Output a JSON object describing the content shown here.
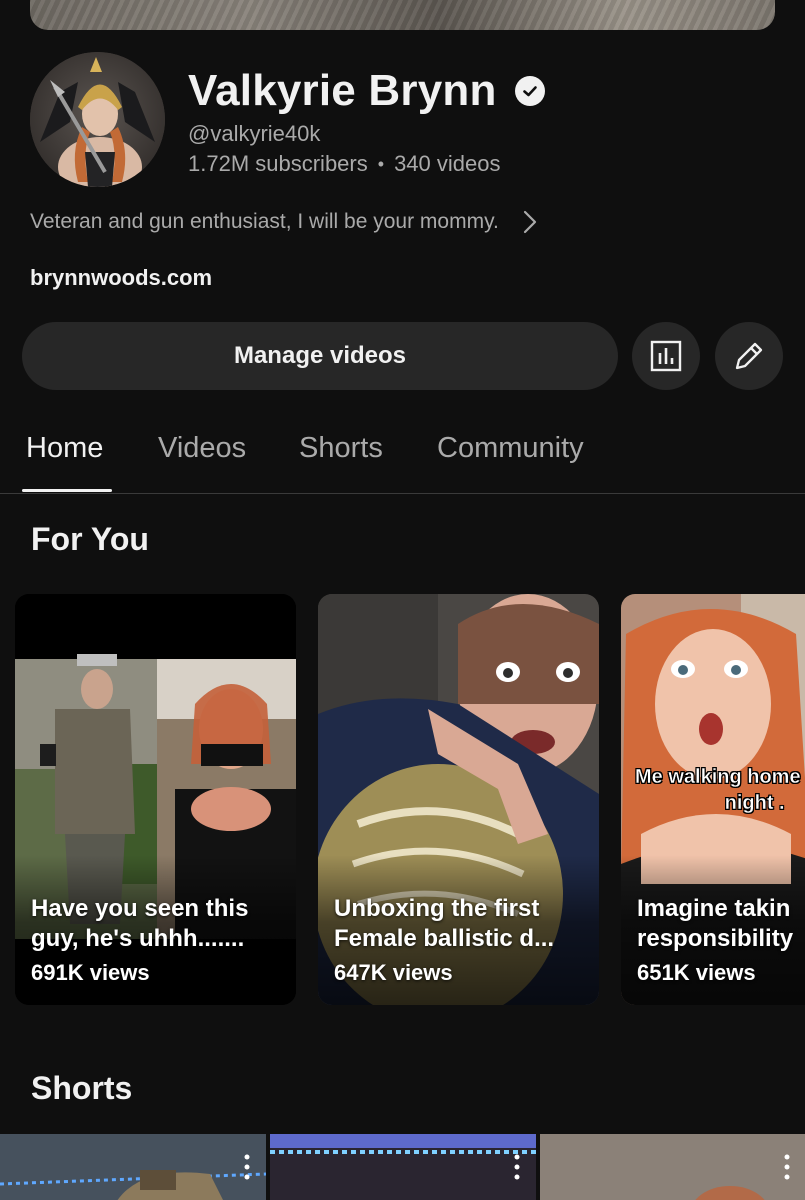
{
  "channel": {
    "name": "Valkyrie Brynn",
    "handle": "@valkyrie40k",
    "subscribers": "1.72M subscribers",
    "separator": "•",
    "videos_count": "340 videos",
    "description": "Veteran and gun enthusiast, I will be your mommy.",
    "link": "brynnwoods.com"
  },
  "actions": {
    "manage_videos": "Manage videos"
  },
  "tabs": [
    {
      "label": "Home",
      "active": true
    },
    {
      "label": "Videos",
      "active": false
    },
    {
      "label": "Shorts",
      "active": false
    },
    {
      "label": "Community",
      "active": false
    }
  ],
  "for_you": {
    "title": "For You",
    "cards": [
      {
        "title": "Have you seen this\nguy, he's uhhh.......",
        "views": "691K views"
      },
      {
        "title": "Unboxing the first\nFemale ballistic d...",
        "views": "647K views"
      },
      {
        "title": "Imagine takin\nresponsibility",
        "views": "651K views",
        "caption_line1": "Me walking home",
        "caption_line2": "night ."
      }
    ]
  },
  "shorts": {
    "title": "Shorts"
  },
  "icons": {
    "verified": "check-badge-icon",
    "description_more": "chevron-right-icon",
    "analytics": "bar-chart-icon",
    "edit": "pencil-icon",
    "short_menu": "more-vertical-icon"
  }
}
